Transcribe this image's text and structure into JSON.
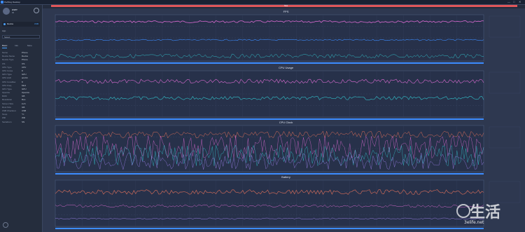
{
  "window": {
    "title": "PerfDog Desktop",
    "controls": [
      "—",
      "□",
      "✕"
    ]
  },
  "sidebar": {
    "user_name": "user",
    "user_id": "ID",
    "device": "Device",
    "device_action": "USB",
    "app_label": "App",
    "app_select": "Select",
    "tabs": [
      {
        "label": "Basic"
      },
      {
        "label": "Info"
      },
      {
        "label": "More"
      }
    ],
    "info": [
      {
        "k": "Name",
        "v": "Phone"
      },
      {
        "k": "Device Name",
        "v": "Device"
      },
      {
        "k": "Device Type",
        "v": "Phone"
      },
      {
        "k": "OS",
        "v": "OS"
      },
      {
        "k": "CPU Type",
        "v": "CPU"
      },
      {
        "k": "CPU Cores",
        "v": "8"
      },
      {
        "k": "GPU Type",
        "v": "GPU"
      },
      {
        "k": "CPU Arch",
        "v": "arm64"
      },
      {
        "k": "CPU CoreMax",
        "v": "8"
      },
      {
        "k": "CPU Freq",
        "v": "MHz"
      },
      {
        "k": "GPU Type",
        "v": "GPU"
      },
      {
        "k": "OpenGL",
        "v": "OpenGL"
      },
      {
        "k": "RAM",
        "v": "GB"
      },
      {
        "k": "Resolution",
        "v": "Res"
      },
      {
        "k": "Screen Size",
        "v": "inch"
      },
      {
        "k": "Root Size",
        "v": "GB"
      },
      {
        "k": "USB Checkout",
        "v": "USB"
      },
      {
        "k": "Temp",
        "v": "°C"
      },
      {
        "k": "Wifi",
        "v": "Wifi"
      },
      {
        "k": "Serialnum",
        "v": "SN"
      }
    ]
  },
  "main": {
    "top_tab": "",
    "record_label": "Stop",
    "panels": [
      {
        "title": "FPS"
      },
      {
        "title": "CPU Usage"
      },
      {
        "title": "CPU Clock"
      },
      {
        "title": "Battery"
      }
    ]
  },
  "watermark": {
    "logo_text": "生活",
    "url": "3elife.net"
  },
  "colors": {
    "pink": "#d96ad0",
    "blue": "#3c8cff",
    "cyan": "#33c2cc",
    "orange": "#e0705a"
  }
}
